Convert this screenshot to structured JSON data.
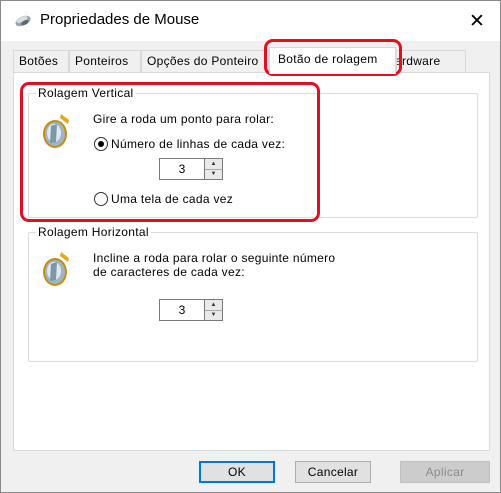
{
  "window": {
    "title": "Propriedades de Mouse",
    "close_icon": "close-icon",
    "app_icon": "mouse-icon"
  },
  "tabs": [
    {
      "label": "Botões",
      "active": false
    },
    {
      "label": "Ponteiros",
      "active": false
    },
    {
      "label": "Opções do Ponteiro",
      "active": false
    },
    {
      "label": "Botão de rolagem",
      "active": true
    },
    {
      "label": "Hardware",
      "active": false
    }
  ],
  "vertical": {
    "legend": "Rolagem Vertical",
    "icon": "scroll-wheel-icon",
    "description": "Gire a roda um ponto para rolar:",
    "option_lines": "Número de linhas de cada vez:",
    "option_lines_checked": true,
    "lines_value": "3",
    "option_screen": "Uma tela de cada vez",
    "option_screen_checked": false
  },
  "horizontal": {
    "legend": "Rolagem Horizontal",
    "icon": "scroll-wheel-icon",
    "description_line1": "Incline a roda para rolar o seguinte número",
    "description_line2": "de caracteres de cada vez:",
    "chars_value": "3"
  },
  "buttons": {
    "ok": "OK",
    "cancel": "Cancelar",
    "apply": "Aplicar",
    "apply_enabled": false
  },
  "annotation_color": "#e0101e",
  "accent_color": "#0078d7"
}
